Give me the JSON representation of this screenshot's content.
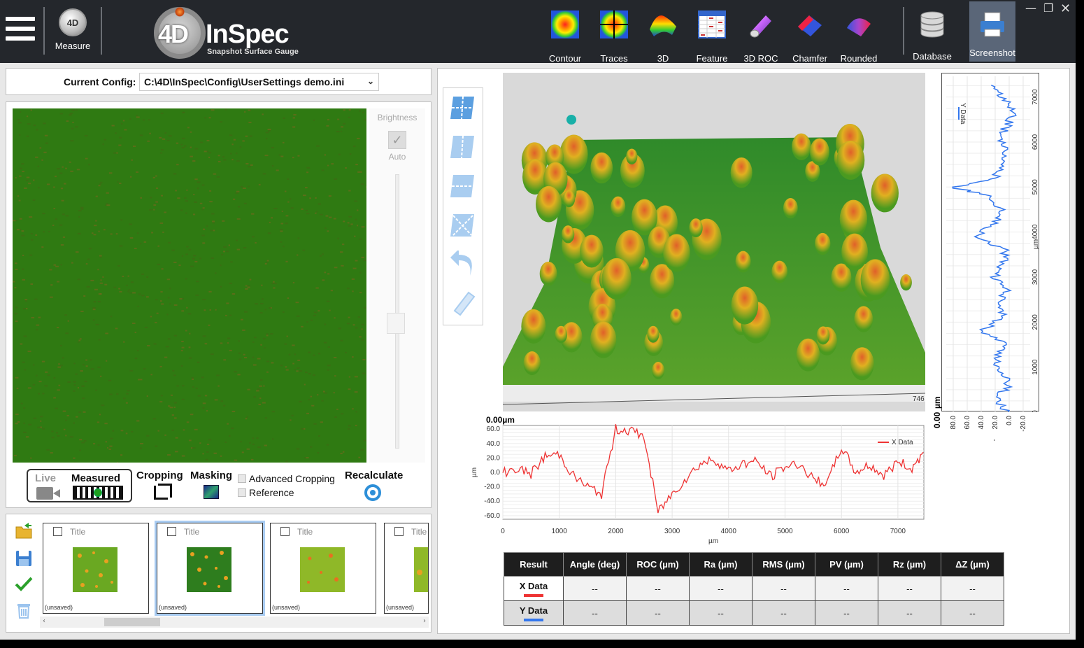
{
  "toolbar": {
    "measure_label": "Measure",
    "logo_name": "InSpec",
    "logo_four": "4D",
    "logo_sub": "Snapshot Surface Gauge",
    "measure_icon_text": "4D",
    "tools": [
      {
        "label": "Contour",
        "icon": "contour-icon"
      },
      {
        "label": "Traces",
        "icon": "traces-icon"
      },
      {
        "label": "3D",
        "icon": "3d-surface-icon"
      },
      {
        "label": "Feature",
        "icon": "feature-table-icon"
      },
      {
        "label": "3D ROC",
        "icon": "cylinder-icon"
      },
      {
        "label": "Chamfer",
        "icon": "chamfer-icon"
      },
      {
        "label": "Rounded",
        "icon": "rounded-icon"
      },
      {
        "label": "Database",
        "icon": "database-icon"
      },
      {
        "label": "Screenshot",
        "icon": "printer-icon"
      }
    ]
  },
  "config": {
    "label": "Current Config:",
    "value": "C:\\4D\\InSpec\\Config\\UserSettings demo.ini"
  },
  "image_panel": {
    "brightness_label": "Brightness",
    "auto_label": "Auto",
    "live_label": "Live",
    "measured_label": "Measured",
    "cropping_label": "Cropping",
    "masking_label": "Masking",
    "advanced_cropping_label": "Advanced Cropping",
    "reference_label": "Reference",
    "recalculate_label": "Recalculate"
  },
  "thumbnails": [
    {
      "title": "Title",
      "status": "(unsaved)",
      "selected": false
    },
    {
      "title": "Title",
      "status": "(unsaved)",
      "selected": true
    },
    {
      "title": "Title",
      "status": "(unsaved)",
      "selected": false
    },
    {
      "title": "Title",
      "status": "(unsaved)",
      "selected": false
    }
  ],
  "plot3d": {
    "axis_end_label": "746",
    "zero_label": "0.00",
    "unit": "µm"
  },
  "x_trace": {
    "legend": "X Data",
    "x_unit": "µm",
    "y_unit": "µm",
    "zero_label": "0.00",
    "color": "#ee3333"
  },
  "y_trace": {
    "legend": "Y Data",
    "unit": "µm",
    "zero_label": "0.00",
    "color": "#3377ee"
  },
  "chart_data": [
    {
      "type": "line",
      "name": "x-profile",
      "series": [
        {
          "name": "X Data",
          "color": "#ee3333"
        }
      ],
      "x": [
        0,
        250,
        500,
        750,
        1000,
        1250,
        1500,
        1750,
        2000,
        2250,
        2500,
        2750,
        3000,
        3250,
        3500,
        3750,
        4000,
        4250,
        4500,
        4750,
        5000,
        5250,
        5500,
        5750,
        6000,
        6250,
        6500,
        6750,
        7000,
        7250,
        7450
      ],
      "y": [
        0,
        5,
        -2,
        22,
        25,
        -5,
        -20,
        -30,
        60,
        58,
        50,
        -55,
        -30,
        -8,
        12,
        18,
        2,
        12,
        15,
        -6,
        8,
        12,
        -10,
        -15,
        35,
        0,
        10,
        -5,
        15,
        5,
        28
      ],
      "xlabel": "µm",
      "ylabel": "µm",
      "xticks": [
        0,
        1000,
        2000,
        3000,
        4000,
        5000,
        6000,
        7000
      ],
      "yticks": [
        -60,
        -40,
        -20,
        0,
        20,
        40,
        60
      ],
      "xlim": [
        0,
        7460
      ],
      "ylim": [
        -65,
        65
      ],
      "grid": true,
      "legend": "top-right"
    },
    {
      "type": "line",
      "name": "y-profile",
      "series": [
        {
          "name": "Y Data",
          "color": "#3377ee"
        }
      ],
      "pos": [
        0,
        300,
        600,
        900,
        1200,
        1500,
        1800,
        2100,
        2400,
        2700,
        3000,
        3300,
        3600,
        3900,
        4200,
        4500,
        4800,
        5000,
        5200,
        5500,
        5800,
        6100,
        6400,
        6700,
        7000,
        7300
      ],
      "val": [
        5,
        20,
        0,
        10,
        20,
        5,
        40,
        10,
        15,
        5,
        20,
        10,
        5,
        50,
        20,
        10,
        30,
        80,
        20,
        10,
        5,
        15,
        0,
        -5,
        10,
        30
      ],
      "xlabel": "µm",
      "ylabel": "µm",
      "valticks": [
        80,
        60,
        40,
        20,
        0,
        -20
      ],
      "posticks": [
        0,
        1000,
        2000,
        3000,
        4000,
        5000,
        6000,
        7000
      ],
      "poslim": [
        0,
        7460
      ],
      "vallim": [
        -30,
        90
      ],
      "grid": true,
      "legend": "top-left"
    }
  ],
  "results": {
    "headers": [
      "Result",
      "Angle (deg)",
      "ROC (µm)",
      "Ra (µm)",
      "RMS (µm)",
      "PV (µm)",
      "Rz (µm)",
      "ΔZ (µm)"
    ],
    "rows": [
      {
        "name": "X Data",
        "color": "#ee3333",
        "values": [
          "--",
          "--",
          "--",
          "--",
          "--",
          "--",
          "--"
        ]
      },
      {
        "name": "Y Data",
        "color": "#3377ee",
        "values": [
          "--",
          "--",
          "--",
          "--",
          "--",
          "--",
          "--"
        ]
      }
    ]
  }
}
